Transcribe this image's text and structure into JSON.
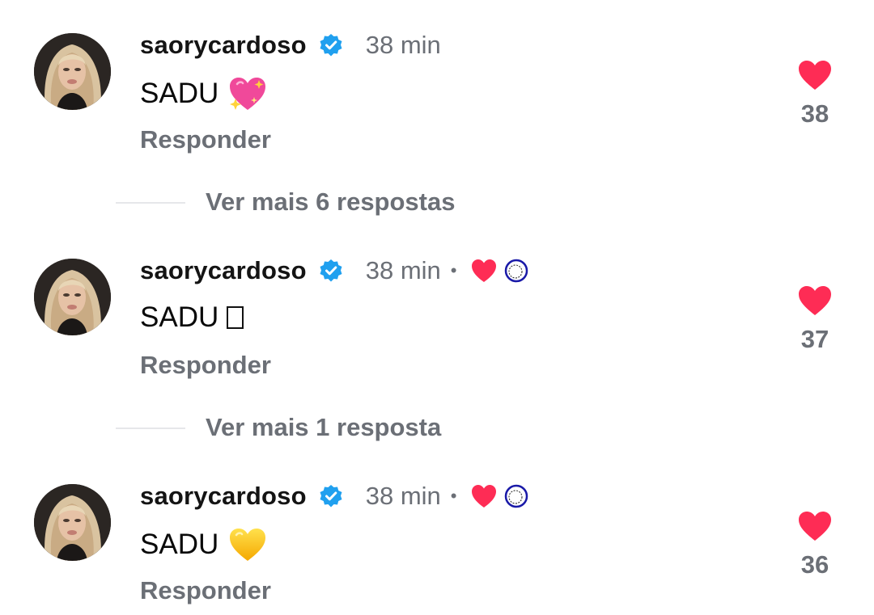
{
  "comments": [
    {
      "username": "saorycardoso",
      "time": "38 min",
      "text": "SADU",
      "emoji": "sparkling-heart",
      "reply_label": "Responder",
      "likes": "38",
      "creator_liked": false
    },
    {
      "username": "saorycardoso",
      "time": "38 min",
      "text": "SADU",
      "emoji": "missing-glyph",
      "reply_label": "Responder",
      "likes": "37",
      "creator_liked": true
    },
    {
      "username": "saorycardoso",
      "time": "38 min",
      "text": "SADU",
      "emoji": "yellow-heart",
      "reply_label": "Responder",
      "likes": "36",
      "creator_liked": true
    }
  ],
  "more_replies": [
    {
      "label": "Ver mais 6 respostas"
    },
    {
      "label": "Ver mais 1 resposta"
    }
  ],
  "colors": {
    "like_heart": "#fe2c55",
    "verified_badge": "#20a0ef",
    "muted_text": "#6b6f76",
    "divider": "#e6e7ea"
  },
  "separator": "•"
}
